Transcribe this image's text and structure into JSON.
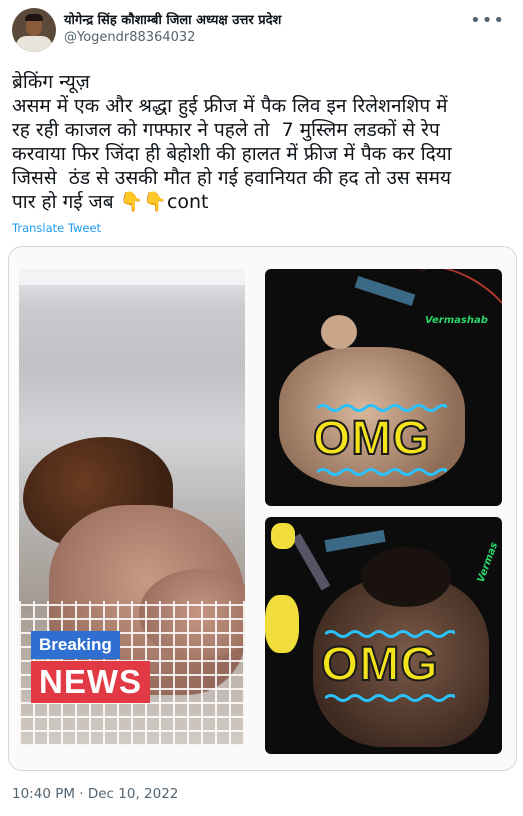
{
  "author": {
    "display_name": "योगेन्द्र सिंह कौशाम्बी जिला अध्यक्ष उत्तर प्रदेश",
    "handle": "@Yogendr88364032"
  },
  "tweet": {
    "text": "ब्रेकिंग न्यूज़\nअसम में एक और श्रद्धा हुई फ्रीज में पैक लिव इन रिलेशनशिप में\nरह रही काजल को गफ्फार ने पहले तो  7 मुस्लिम लडकों से रेप\nकरवाया फिर जिंदा ही बेहोशी की हालत में फ्रीज में पैक कर दिया\nजिससे  ठंड से उसकी मौत हो गई हवानियत की हद तो उस समय\nपार हो गई जब 👇👇cont",
    "translate_label": "Translate Tweet",
    "timestamp": "10:40 PM · Dec 10, 2022"
  },
  "media": {
    "overlay_breaking": "Breaking",
    "overlay_news": "NEWS",
    "omg_top": "OMG",
    "omg_bottom": "OMG",
    "watermark_top": "Vermashab",
    "watermark_bottom": "Vermas",
    "omg_color": "#f3e21c",
    "news_color": "#e23a44",
    "breaking_color": "#2f6fd1"
  },
  "icons": {
    "more": "more-horizontal-icon"
  }
}
